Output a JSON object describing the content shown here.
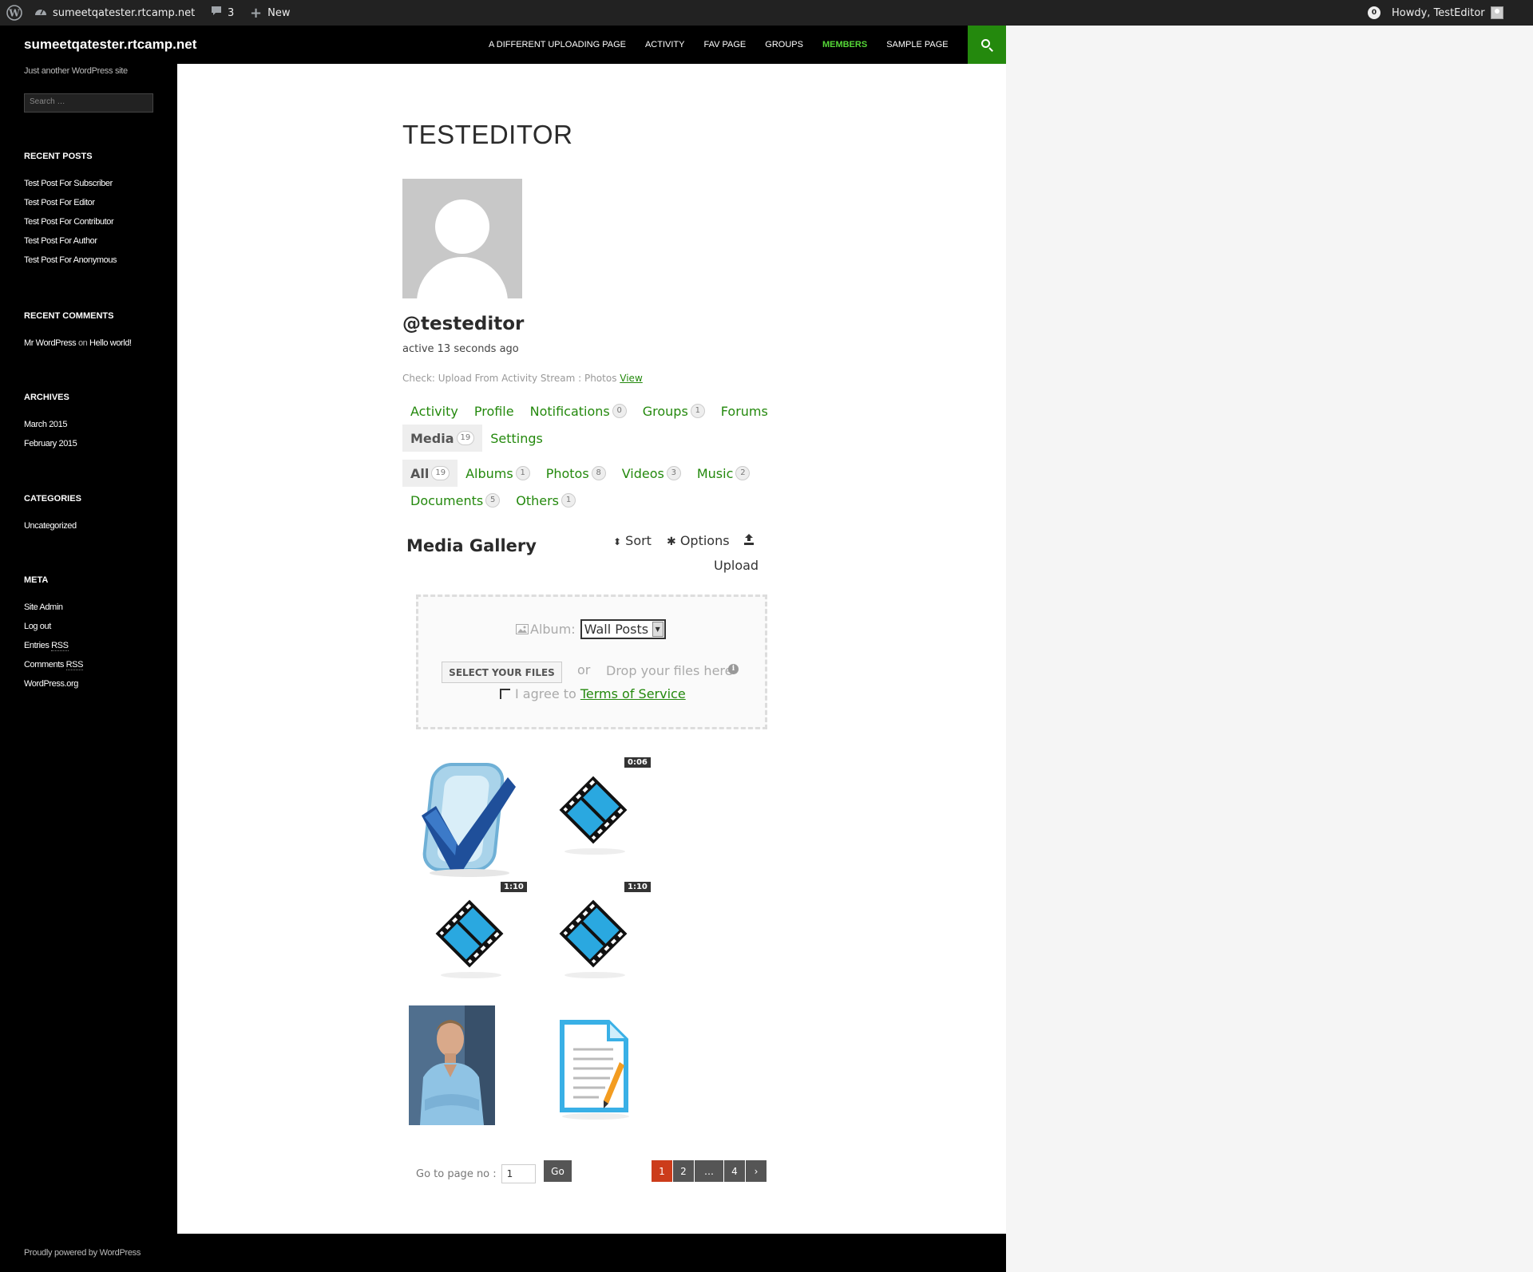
{
  "admin_bar": {
    "site_name": "sumeetqatester.rtcamp.net",
    "comments_count": "3",
    "new_label": "New",
    "notifications_count": "0",
    "howdy": "Howdy, TestEditor"
  },
  "site": {
    "title": "sumeetqatester.rtcamp.net",
    "description": "Just another WordPress site",
    "search_placeholder": "Search …",
    "footer": "Proudly powered by WordPress"
  },
  "nav": {
    "items": [
      {
        "label": "A Different Uploading Page"
      },
      {
        "label": "Activity"
      },
      {
        "label": "Fav Page"
      },
      {
        "label": "Groups"
      },
      {
        "label": "Members",
        "current": true
      },
      {
        "label": "Sample Page"
      }
    ]
  },
  "sidebar": {
    "recent_posts_title": "RECENT POSTS",
    "recent_posts": [
      "Test Post For Subscriber",
      "Test Post For Editor",
      "Test Post For Contributor",
      "Test Post For Author",
      "Test Post For Anonymous"
    ],
    "recent_comments_title": "RECENT COMMENTS",
    "recent_comment": {
      "author": "Mr WordPress",
      "on": "on",
      "post": "Hello world!"
    },
    "archives_title": "ARCHIVES",
    "archives": [
      "March 2015",
      "February 2015"
    ],
    "categories_title": "CATEGORIES",
    "categories": [
      "Uncategorized"
    ],
    "meta_title": "META",
    "meta": {
      "site_admin": "Site Admin",
      "log_out": "Log out",
      "entries": "Entries",
      "comments": "Comments",
      "rss": "RSS",
      "wordpress_org": "WordPress.org"
    }
  },
  "profile": {
    "page_title": "TESTEDITOR",
    "handle": "@testeditor",
    "last_active": "active 13 seconds ago",
    "latest_update": "Check: Upload From Activity Stream : Photos",
    "latest_update_link": "View"
  },
  "member_tabs": [
    {
      "label": "Activity"
    },
    {
      "label": "Profile"
    },
    {
      "label": "Notifications",
      "count": "0"
    },
    {
      "label": "Groups",
      "count": "1"
    },
    {
      "label": "Forums"
    },
    {
      "label": "Media",
      "count": "19",
      "current": true
    },
    {
      "label": "Settings"
    }
  ],
  "media_tabs": [
    {
      "label": "All",
      "count": "19",
      "current": true
    },
    {
      "label": "Albums",
      "count": "1"
    },
    {
      "label": "Photos",
      "count": "8"
    },
    {
      "label": "Videos",
      "count": "3"
    },
    {
      "label": "Music",
      "count": "2"
    },
    {
      "label": "Documents",
      "count": "5"
    },
    {
      "label": "Others",
      "count": "1"
    }
  ],
  "gallery": {
    "title": "Media Gallery",
    "sort_label": "Sort",
    "options_label": "Options",
    "upload_label": "Upload",
    "album_label": "Album:",
    "album_selected": "Wall Posts",
    "select_files_label": "SELECT YOUR FILES",
    "or_label": "or",
    "drop_label": "Drop your files here",
    "agree_label": "I agree to",
    "tos_link": "Terms of Service",
    "durations": [
      "0:06",
      "1:10",
      "1:10"
    ]
  },
  "pagination": {
    "goto_label": "Go to page no :",
    "goto_value": "1",
    "go_label": "Go",
    "pages": [
      "1",
      "2",
      "…",
      "4",
      "›"
    ],
    "current": "1"
  },
  "colors": {
    "accent": "#24890d",
    "accent_light": "#55d737",
    "pager_current": "#cc3c1b"
  }
}
